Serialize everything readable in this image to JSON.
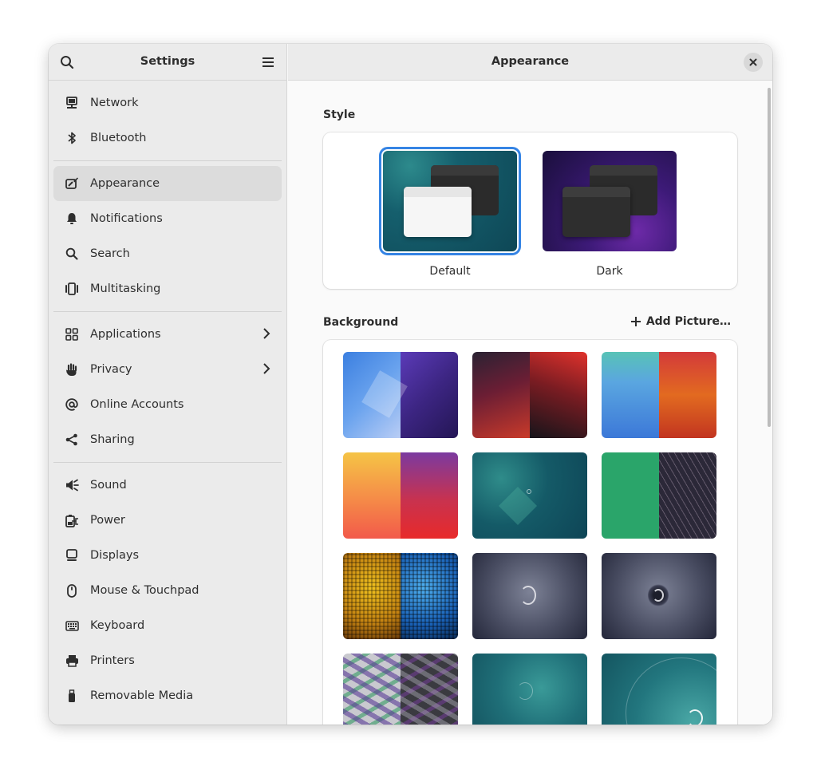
{
  "sidebar": {
    "title": "Settings",
    "groups": [
      [
        {
          "label": "Network",
          "icon": "network-icon"
        },
        {
          "label": "Bluetooth",
          "icon": "bluetooth-icon"
        }
      ],
      [
        {
          "label": "Appearance",
          "icon": "appearance-icon",
          "selected": true
        },
        {
          "label": "Notifications",
          "icon": "bell-icon"
        },
        {
          "label": "Search",
          "icon": "search-icon"
        },
        {
          "label": "Multitasking",
          "icon": "multitasking-icon"
        }
      ],
      [
        {
          "label": "Applications",
          "icon": "grid-icon",
          "chevron": true
        },
        {
          "label": "Privacy",
          "icon": "hand-icon",
          "chevron": true
        },
        {
          "label": "Online Accounts",
          "icon": "at-icon"
        },
        {
          "label": "Sharing",
          "icon": "share-icon"
        }
      ],
      [
        {
          "label": "Sound",
          "icon": "speaker-icon"
        },
        {
          "label": "Power",
          "icon": "battery-icon"
        },
        {
          "label": "Displays",
          "icon": "display-icon"
        },
        {
          "label": "Mouse & Touchpad",
          "icon": "mouse-icon"
        },
        {
          "label": "Keyboard",
          "icon": "keyboard-icon"
        },
        {
          "label": "Printers",
          "icon": "printer-icon"
        },
        {
          "label": "Removable Media",
          "icon": "usb-icon"
        }
      ]
    ]
  },
  "main": {
    "title": "Appearance",
    "style_section": {
      "title": "Style",
      "options": [
        {
          "label": "Default",
          "selected": true
        },
        {
          "label": "Dark",
          "selected": false
        }
      ]
    },
    "background_section": {
      "title": "Background",
      "add_label": "Add Picture…"
    }
  },
  "colors": {
    "accent": "#3584e4",
    "sidebar_bg": "#ebebeb",
    "selected_row": "#dcdcdc"
  }
}
